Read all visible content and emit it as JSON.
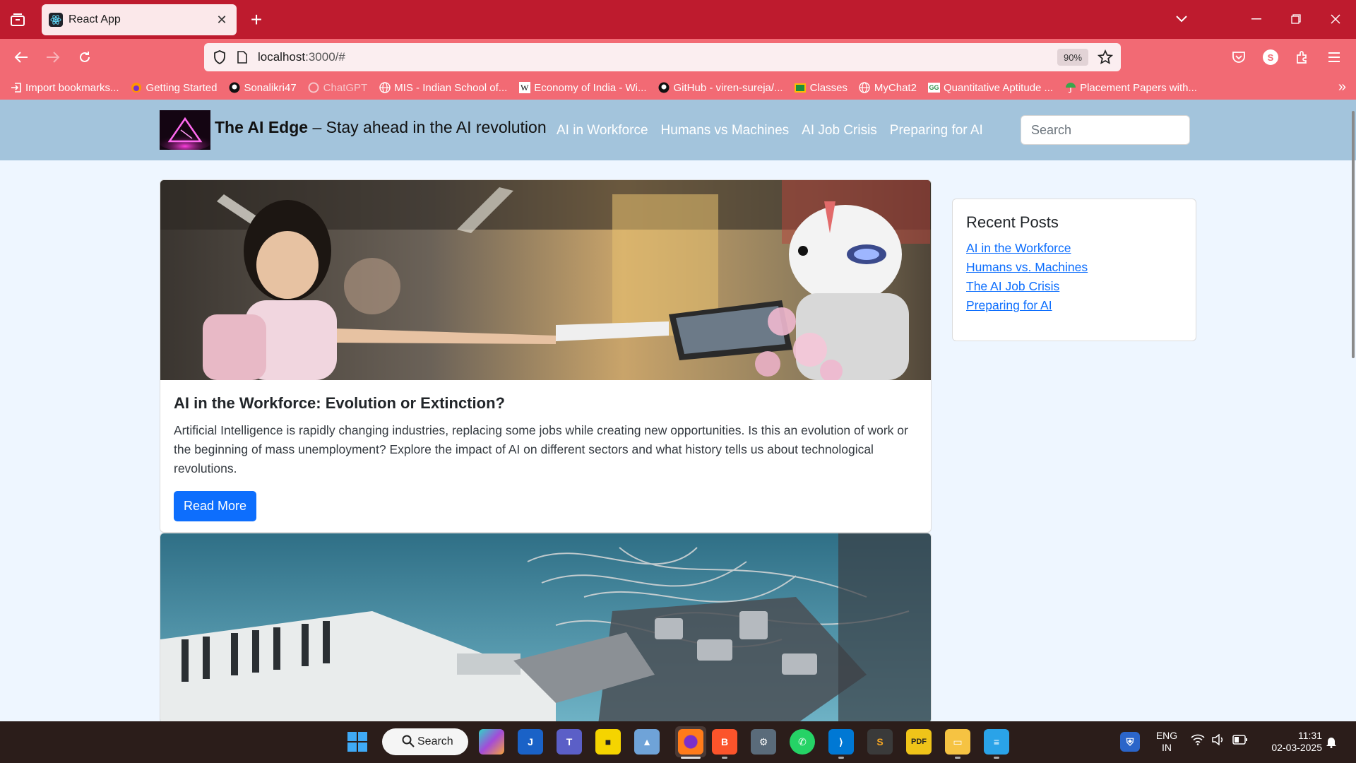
{
  "browser": {
    "tab": {
      "title": "React App",
      "close": "✕"
    },
    "new_tab": "+",
    "url_host": "localhost",
    "url_path": ":3000/#",
    "zoom": "90%",
    "bookmarks": [
      {
        "label": "Import bookmarks...",
        "icon": "import-icon"
      },
      {
        "label": "Getting Started",
        "icon": "firefox-icon"
      },
      {
        "label": "Sonalikri47",
        "icon": "github-icon"
      },
      {
        "label": "ChatGPT",
        "icon": "chatgpt-icon"
      },
      {
        "label": "MIS - Indian School of...",
        "icon": "globe-icon"
      },
      {
        "label": "Economy of India - Wi...",
        "icon": "wikipedia-icon"
      },
      {
        "label": "GitHub - viren-sureja/...",
        "icon": "github-icon"
      },
      {
        "label": "Classes",
        "icon": "classroom-icon"
      },
      {
        "label": "MyChat2",
        "icon": "globe-icon"
      },
      {
        "label": "Quantitative Aptitude ...",
        "icon": "geeks-icon"
      },
      {
        "label": "Placement Papers with...",
        "icon": "umbrella-icon"
      }
    ],
    "bookmarks_more": "»"
  },
  "site": {
    "brand_name": "The AI Edge",
    "brand_tagline": " – Stay ahead in the AI revolution",
    "nav": [
      "AI in Workforce",
      "Humans vs Machines",
      "AI Job Crisis",
      "Preparing for AI"
    ],
    "search_placeholder": "Search"
  },
  "posts": [
    {
      "title": "AI in the Workforce: Evolution or Extinction?",
      "text": "Artificial Intelligence is rapidly changing industries, replacing some jobs while creating new opportunities. Is this an evolution of work or the beginning of mass unemployment? Explore the impact of AI on different sectors and what history tells us about technological revolutions.",
      "button": "Read More"
    }
  ],
  "sidebar": {
    "title": "Recent Posts",
    "links": [
      "AI in the Workforce",
      "Humans vs. Machines",
      "The AI Job Crisis",
      "Preparing for AI"
    ]
  },
  "taskbar": {
    "search_label": "Search",
    "lang_top": "ENG",
    "lang_bottom": "IN",
    "time": "11:31",
    "date": "02-03-2025"
  },
  "colors": {
    "tab_strip": "#be1b2e",
    "toolbar": "#f26a74",
    "site_header": "#a3c4dc",
    "page_bg": "#eef6ff",
    "primary": "#0d6efd"
  }
}
